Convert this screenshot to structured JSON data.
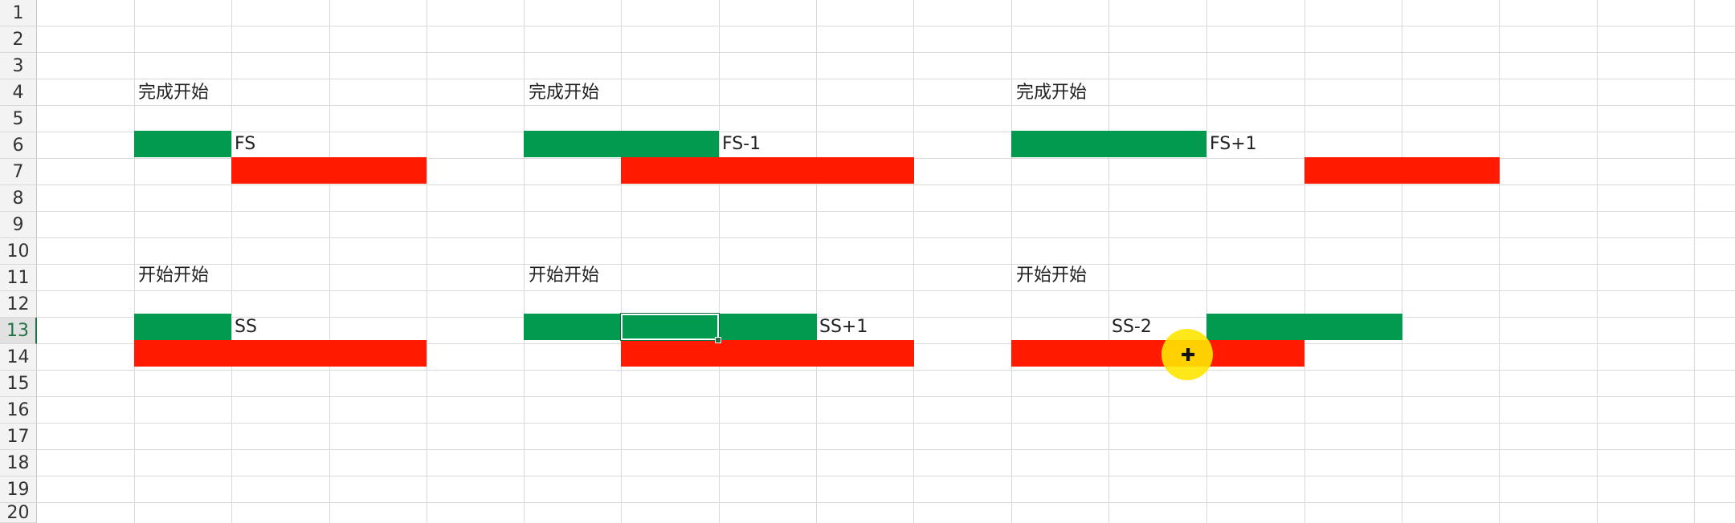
{
  "row_headers": [
    "1",
    "2",
    "3",
    "4",
    "5",
    "6",
    "7",
    "8",
    "9",
    "10",
    "11",
    "12",
    "13",
    "14",
    "15",
    "16",
    "17",
    "18",
    "19",
    "20"
  ],
  "active_row": "13",
  "titles": {
    "top_left": "完成开始",
    "top_mid": "完成开始",
    "top_right": "完成开始",
    "bottom_left": "开始开始",
    "bottom_mid": "开始开始",
    "bottom_right": "开始开始"
  },
  "labels": {
    "fs": "FS",
    "fs_minus_1": "FS-1",
    "fs_plus_1": "FS+1",
    "ss": "SS",
    "ss_plus_1": "SS+1",
    "ss_minus_2": "SS-2"
  },
  "colors": {
    "predecessor_bar": "#019a4e",
    "successor_bar": "#ff1a00",
    "cursor_highlight": "#ffe600",
    "selection": "#217346"
  },
  "icons": {
    "cursor": "cell-select-cross-icon"
  }
}
